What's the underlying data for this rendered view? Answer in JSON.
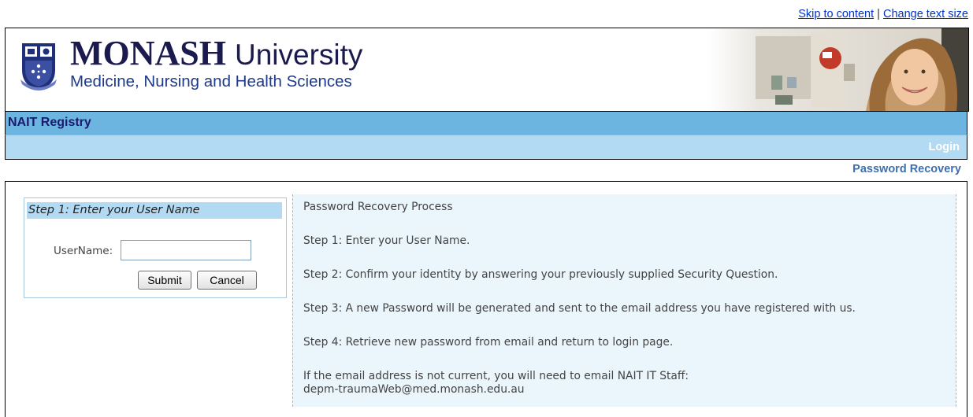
{
  "top_links": {
    "skip": "Skip to content",
    "separator": "|",
    "change_text": "Change text size"
  },
  "header": {
    "brand_name": "MONASH",
    "brand_suffix": "University",
    "faculty": "Medicine, Nursing and Health Sciences"
  },
  "nav": {
    "app_title": "NAIT Registry",
    "login": "Login",
    "page_title": "Password Recovery"
  },
  "form": {
    "step_title": "Step 1: Enter your User Name",
    "username_label": "UserName:",
    "username_value": "",
    "submit": "Submit",
    "cancel": "Cancel"
  },
  "info": {
    "heading": "Password Recovery Process",
    "step1": "Step 1:  Enter your User Name.",
    "step2": "Step 2: Confirm your identity by answering your previously supplied Security Question.",
    "step3": "Step 3: A new Password will be generated and sent to the email address you have registered with us.",
    "step4": "Step 4: Retrieve new password from email and return to login page.",
    "note": "If the email address is not current, you will need to email NAIT IT Staff:",
    "email": "depm-traumaWeb@med.monash.edu.au"
  },
  "colors": {
    "nav_bar": "#6db5e1",
    "sub_bar": "#b2daf3",
    "link": "#0033cc",
    "heading_blue": "#3d6fb0"
  }
}
